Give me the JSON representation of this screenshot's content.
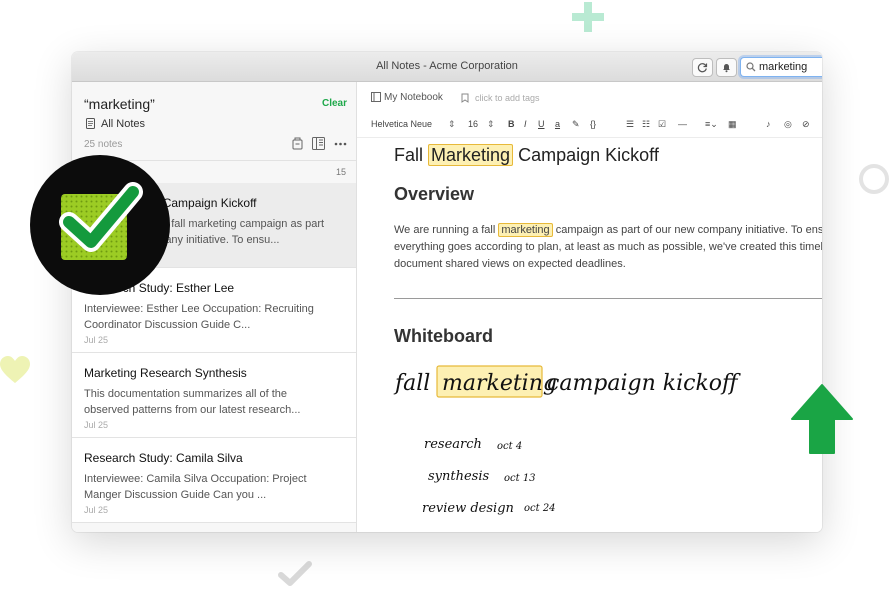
{
  "window": {
    "title": "All Notes - Acme Corporation"
  },
  "toolbar": {
    "sync_icon": "sync-icon",
    "notifications_icon": "bell-icon",
    "search_value": "marketing"
  },
  "sidebar": {
    "search_title": "“marketing”",
    "clear_label": "Clear",
    "scope_label": "All Notes",
    "note_count": "25 notes",
    "list_header_count": "15",
    "notes": [
      {
        "title": "Fall Marketing Campaign Kickoff",
        "snippet": "We are running a fall marketing campaign as part of our new company initiative. To ensu...",
        "date": ""
      },
      {
        "title": "Research Study: Esther Lee",
        "snippet": "Interviewee: Esther Lee Occupation: Recruiting Coordinator Discussion Guide C...",
        "date": "Jul 25"
      },
      {
        "title": "Marketing Research Synthesis",
        "snippet": "This documentation summarizes all of the observed patterns from our latest research...",
        "date": "Jul 25"
      },
      {
        "title": "Research Study: Camila Silva",
        "snippet": "Interviewee: Camila Silva Occupation: Project Manger Discussion Guide Can you ...",
        "date": "Jul 25"
      }
    ]
  },
  "editor": {
    "notebook": "My Notebook",
    "tags_placeholder": "click to add tags",
    "font": "Helvetica Neue",
    "font_size": "16",
    "title_before": "Fall",
    "title_highlight": "Marketing",
    "title_after": "Campaign Kickoff",
    "heading_overview": "Overview",
    "body_before": "We are running a fall",
    "body_highlight": "marketing",
    "body_after": "campaign as part of our new company initiative. To ensure everything goes according to plan, at least as much as possible, we've created this timeline to document shared views on expected deadlines.",
    "heading_whiteboard": "Whiteboard",
    "whiteboard": {
      "line_before": "fall",
      "line_highlight": "marketing",
      "line_after": "campaign kickoff",
      "items": [
        {
          "task": "research",
          "date": "oct 4"
        },
        {
          "task": "synthesis",
          "date": "oct 13"
        },
        {
          "task": "review design",
          "date": "oct 24"
        }
      ]
    }
  },
  "colors": {
    "accent_green": "#1ea84a",
    "highlight_fill": "#fdf0b3",
    "highlight_border": "#e7b93a",
    "search_focus": "#7fb3f0"
  }
}
